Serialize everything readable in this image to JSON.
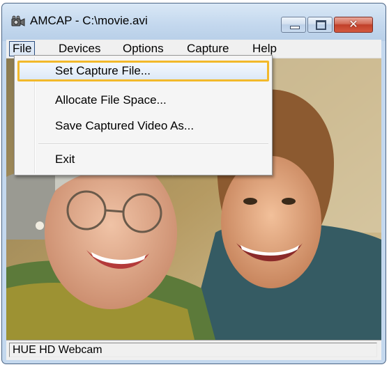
{
  "window": {
    "title": "AMCAP - C:\\movie.avi",
    "close_glyph": "✕"
  },
  "menubar": {
    "items": [
      {
        "label": "File"
      },
      {
        "label": "Devices"
      },
      {
        "label": "Options"
      },
      {
        "label": "Capture"
      },
      {
        "label": "Help"
      }
    ]
  },
  "file_menu": {
    "items": [
      {
        "label": "Set Capture File..."
      },
      {
        "label": "Allocate File Space..."
      },
      {
        "label": "Save Captured Video As..."
      },
      {
        "label": "Exit"
      }
    ],
    "highlighted_item": "Set Capture File..."
  },
  "statusbar": {
    "text": "HUE HD Webcam"
  },
  "colors": {
    "highlight_border": "#f2b92b",
    "close_button": "#c0402a"
  }
}
